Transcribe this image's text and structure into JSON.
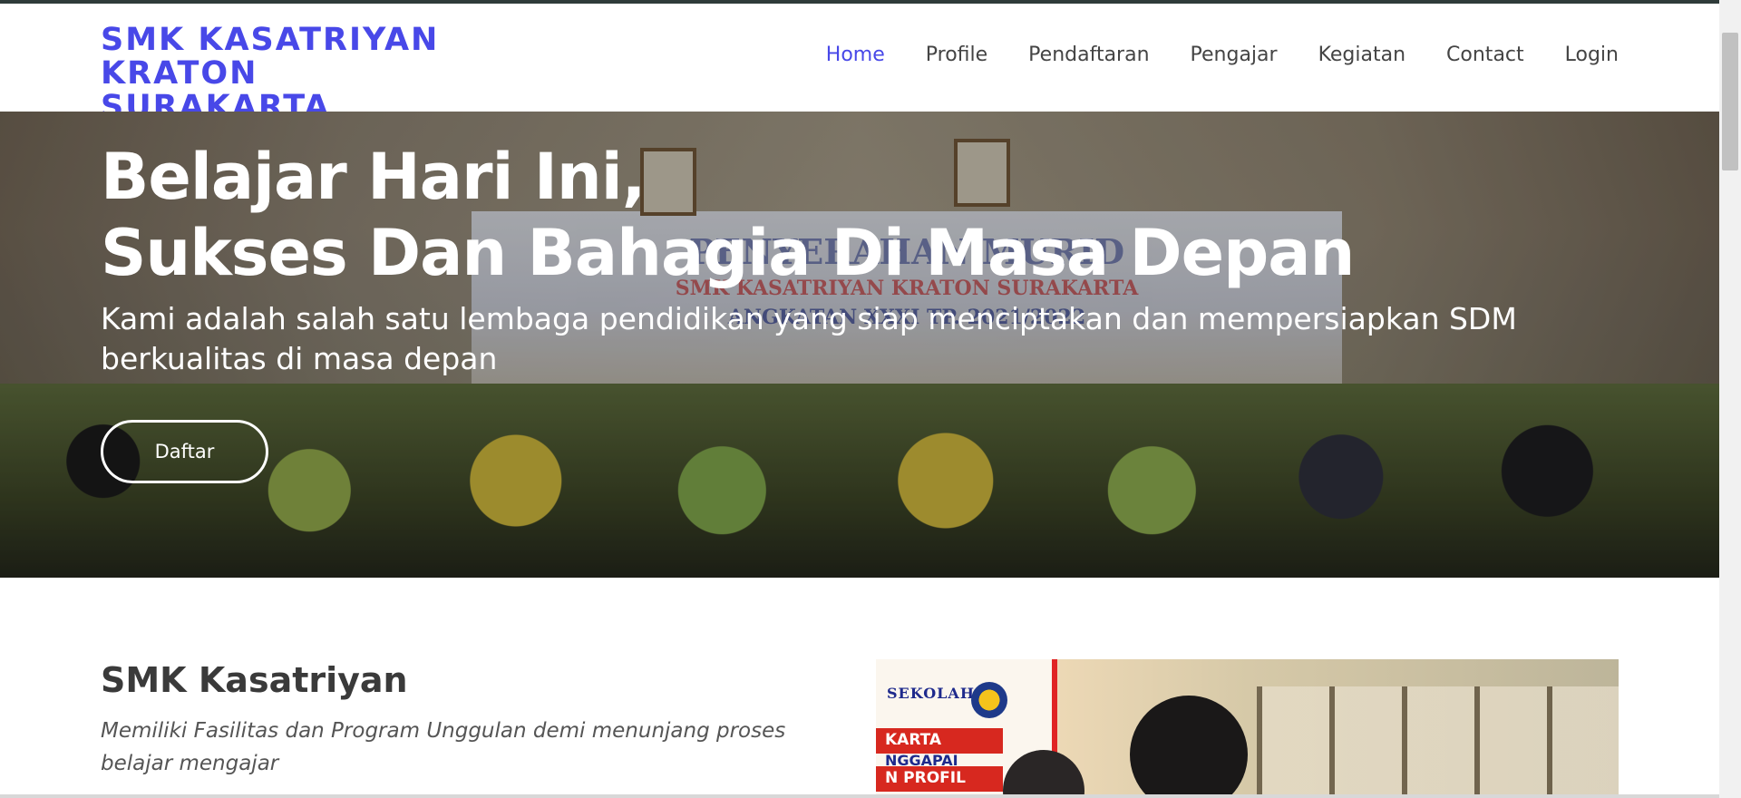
{
  "header": {
    "brand_line1": "SMK KASATRIYAN KRATON",
    "brand_line2": "SURAKARTA",
    "nav": [
      {
        "label": "Home",
        "active": true
      },
      {
        "label": "Profile",
        "active": false
      },
      {
        "label": "Pendaftaran",
        "active": false
      },
      {
        "label": "Pengajar",
        "active": false
      },
      {
        "label": "Kegiatan",
        "active": false
      },
      {
        "label": "Contact",
        "active": false
      },
      {
        "label": "Login",
        "active": false
      }
    ]
  },
  "hero": {
    "title_line1": "Belajar Hari Ini,",
    "title_line2": "Sukses Dan Bahagia Di Masa Depan",
    "subtitle": "Kami adalah salah satu lembaga pendidikan yang siap menciptakan dan mempersiapkan SDM berkualitas di masa depan",
    "button_label": "Daftar",
    "image_text_1": "PENYERAHAN MURID",
    "image_text_2": "SMK KASATRIYAN KRATON SURAKARTA",
    "image_text_3": "ANGKATAN XXXI TP. 2021/2022"
  },
  "about": {
    "title": "SMK Kasatriyan",
    "description": "Memiliki Fasilitas dan Program Unggulan demi menunjang proses belajar mengajar",
    "image_poster_text": "SEKOLAH",
    "image_poster_band1": "KARTA",
    "image_poster_band2": "NGGAPAI",
    "image_poster_band3": "N PROFIL"
  },
  "colors": {
    "brand": "#4848e8",
    "nav_text": "#444444",
    "hero_text": "#ffffff"
  }
}
